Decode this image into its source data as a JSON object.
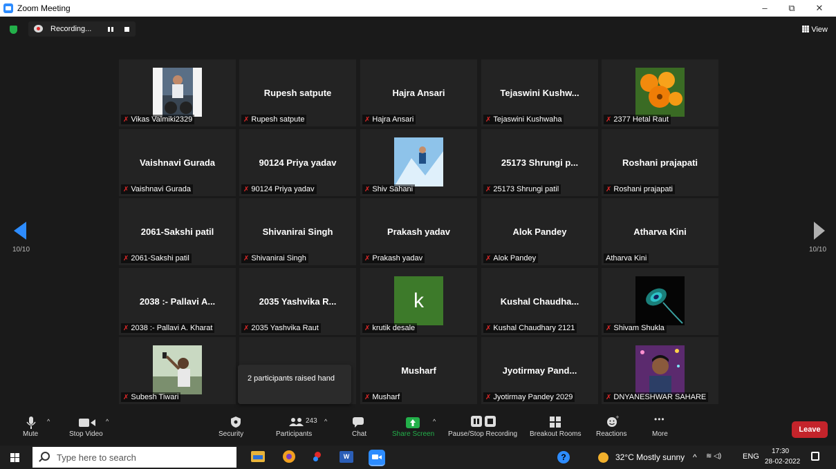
{
  "window": {
    "title": "Zoom Meeting",
    "min": "–",
    "max": "⧉",
    "close": "✕"
  },
  "recording": {
    "label": "Recording..."
  },
  "view": {
    "label": "View"
  },
  "gallery": {
    "page_left": "10/10",
    "page_right": "10/10",
    "tiles": [
      {
        "display": "",
        "name": "Vikas Valmiki2329",
        "muted": true,
        "photo": "person-bike"
      },
      {
        "display": "Rupesh satpute",
        "name": "Rupesh satpute",
        "muted": true
      },
      {
        "display": "Hajra Ansari",
        "name": "Hajra Ansari",
        "muted": true
      },
      {
        "display": "Tejaswini  Kushw...",
        "name": "Tejaswini Kushwaha",
        "muted": true
      },
      {
        "display": "",
        "name": "2377 Hetal Raut",
        "muted": true,
        "photo": "orange-flowers"
      },
      {
        "display": "Vaishnavi Gurada",
        "name": "Vaishnavi Gurada",
        "muted": true
      },
      {
        "display": "90124 Priya yadav",
        "name": "90124 Priya yadav",
        "muted": true
      },
      {
        "display": "",
        "name": "Shiv Sahani",
        "muted": true,
        "photo": "snow-scene"
      },
      {
        "display": "25173  Shrungi  p...",
        "name": "25173 Shrungi patil",
        "muted": true
      },
      {
        "display": "Roshani prajapati",
        "name": "Roshani prajapati",
        "muted": true
      },
      {
        "display": "2061-Sakshi patil",
        "name": "2061-Sakshi patil",
        "muted": true
      },
      {
        "display": "Shivanirai Singh",
        "name": "Shivanirai Singh",
        "muted": true
      },
      {
        "display": "Prakash yadav",
        "name": "Prakash yadav",
        "muted": true
      },
      {
        "display": "Alok Pandey",
        "name": "Alok Pandey",
        "muted": true
      },
      {
        "display": "Atharva Kini",
        "name": "Atharva Kini",
        "muted": false
      },
      {
        "display": "2038 :- Pallavi A...",
        "name": "2038 :- Pallavi A. Kharat",
        "muted": true
      },
      {
        "display": "2035 Yashvika R...",
        "name": "2035 Yashvika Raut",
        "muted": true
      },
      {
        "display": "",
        "name": "krutik desale",
        "muted": true,
        "avatar_letter": "k"
      },
      {
        "display": "Kushal  Chaudha...",
        "name": "Kushal Chaudhary 2121",
        "muted": true
      },
      {
        "display": "",
        "name": "Shivam Shukla",
        "muted": true,
        "photo": "peacock-feather"
      },
      {
        "display": "",
        "name": "Subesh Tiwari",
        "muted": true,
        "photo": "person-selfie"
      },
      {
        "display": "",
        "name": "",
        "muted": false
      },
      {
        "display": "Musharf",
        "name": "Musharf",
        "muted": true
      },
      {
        "display": "Jyotirmay  Pand...",
        "name": "Jyotirmay Pandey 2029",
        "muted": true
      },
      {
        "display": "",
        "name": "DNYANESHWAR SAHARE",
        "muted": true,
        "photo": "person-portrait"
      }
    ]
  },
  "tooltip": {
    "text": "2 participants raised hand"
  },
  "toolbar": {
    "mute": "Mute",
    "stop_video": "Stop Video",
    "security": "Security",
    "participants": "Participants",
    "participants_count": "243",
    "chat": "Chat",
    "share_screen": "Share Screen",
    "pause_stop_recording": "Pause/Stop Recording",
    "breakout_rooms": "Breakout Rooms",
    "reactions": "Reactions",
    "more": "More",
    "leave": "Leave"
  },
  "taskbar": {
    "search_placeholder": "Type here to search",
    "weather": "32°C  Mostly sunny",
    "lang": "ENG",
    "time": "17:30",
    "date": "28-02-2022"
  },
  "colors": {
    "accent": "#2d8cff",
    "leave": "#c4242b",
    "share": "#23b04a",
    "muted": "#e02828"
  }
}
